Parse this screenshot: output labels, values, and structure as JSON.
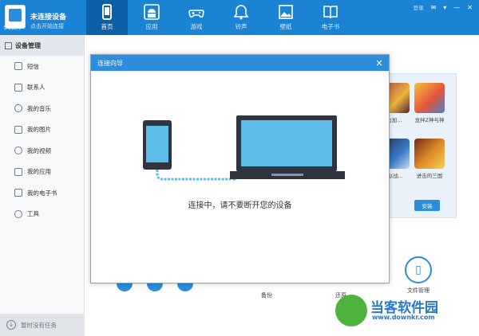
{
  "header": {
    "logo_text": "手机助手",
    "device_title": "未连接设备",
    "device_subtitle": "点击开始连接",
    "window_controls": {
      "text_link": "登录",
      "icons": [
        "skin-icon",
        "menu-icon",
        "minimize-icon",
        "close-icon"
      ]
    },
    "nav": [
      {
        "label": "首页",
        "icon": "phone-icon",
        "active": true
      },
      {
        "label": "应用",
        "icon": "android-icon",
        "active": false
      },
      {
        "label": "游戏",
        "icon": "gamepad-icon",
        "active": false
      },
      {
        "label": "铃声",
        "icon": "bell-icon",
        "active": false
      },
      {
        "label": "壁纸",
        "icon": "image-icon",
        "active": false
      },
      {
        "label": "电子书",
        "icon": "book-icon",
        "active": false
      }
    ]
  },
  "sidebar": {
    "header": "设备管理",
    "items": [
      {
        "label": "短信",
        "icon": "message-icon"
      },
      {
        "label": "联系人",
        "icon": "contacts-icon"
      },
      {
        "label": "我的音乐",
        "icon": "music-icon"
      },
      {
        "label": "我的图片",
        "icon": "camera-icon"
      },
      {
        "label": "我的视频",
        "icon": "video-icon"
      },
      {
        "label": "我的应用",
        "icon": "app-icon"
      },
      {
        "label": "我的电子书",
        "icon": "ebook-icon"
      },
      {
        "label": "工具",
        "icon": "gear-icon"
      }
    ],
    "footer": "暂时没有任务"
  },
  "apps": [
    {
      "name": "力加..."
    },
    {
      "name": "龙拌Z神与神"
    },
    {
      "name": "机(战..."
    },
    {
      "name": "进击的三国"
    }
  ],
  "install_label": "安装",
  "tools": [
    {
      "label": "备份"
    },
    {
      "label": "还原"
    },
    {
      "label": "文件管理"
    }
  ],
  "dialog": {
    "title": "连接向导",
    "close": "×",
    "message": "连接中，请不要断开您的设备"
  },
  "watermark": {
    "name": "当客软件园",
    "url": "www.downkr.com"
  },
  "colors": {
    "primary": "#1b83d4",
    "nav_active": "#0d5fa8",
    "dialog_title": "#2b8ddb",
    "screen": "#5bbde8"
  }
}
